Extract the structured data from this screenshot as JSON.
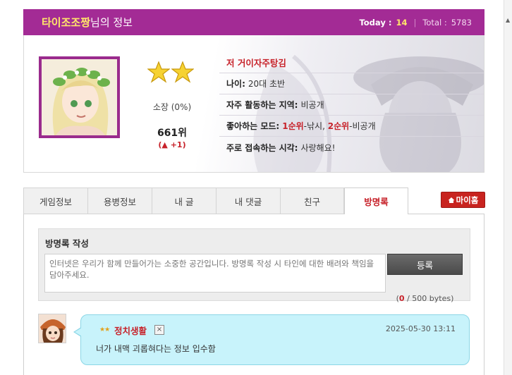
{
  "header": {
    "nickname": "타이조조짱",
    "title_suffix": "님의 정보",
    "today_label": "Today :",
    "today_value": "14",
    "total_label": "Total :",
    "total_value": "5783"
  },
  "profile": {
    "star_count": 2,
    "rank_title": "소장 (0%)",
    "rank": "661위",
    "rank_change": "(▲ +1)",
    "nickname_line": "저 거이자주탕김",
    "age_label": "나이:",
    "age_value": "20대 초반",
    "region_label": "자주 활동하는 지역:",
    "region_value": "비공개",
    "mode_label": "좋아하는 모드:",
    "mode_rank1": "1순위",
    "mode_rank1_value": "-낚시,",
    "mode_rank2": "2순위",
    "mode_rank2_value": "-비공개",
    "time_label": "주로 접속하는 시각:",
    "time_value": "사랑해요!"
  },
  "tabs": [
    {
      "label": "게임정보",
      "active": false
    },
    {
      "label": "용병정보",
      "active": false
    },
    {
      "label": "내 글",
      "active": false
    },
    {
      "label": "내 댓글",
      "active": false
    },
    {
      "label": "친구",
      "active": false
    },
    {
      "label": "방명록",
      "active": true
    }
  ],
  "my_home_button": "마이홈",
  "guestbook": {
    "title": "방명록 작성",
    "placeholder": "인터넷은 우리가 함께 만들어가는 소중한 공간입니다. 방명록 작성 시 타인에 대한 배려와 책임을 담아주세요.",
    "submit_label": "등록",
    "byte_open": "(",
    "byte_current": "0",
    "byte_rest": " / 500 bytes)"
  },
  "comments": [
    {
      "author": "정치생활",
      "stars": "★★",
      "delete_label": "×",
      "date": "2025-05-30 13:11",
      "text": "너가 내맥 괴롭혀다는 정보 입수함"
    }
  ],
  "colors": {
    "brand_purple": "#a32b95",
    "accent_red": "#c7222a",
    "highlight_yellow": "#ffe66a",
    "bubble_blue": "#c8f3fb"
  },
  "icons": {
    "home": "home-icon",
    "star": "star-icon",
    "delete": "close-icon"
  }
}
